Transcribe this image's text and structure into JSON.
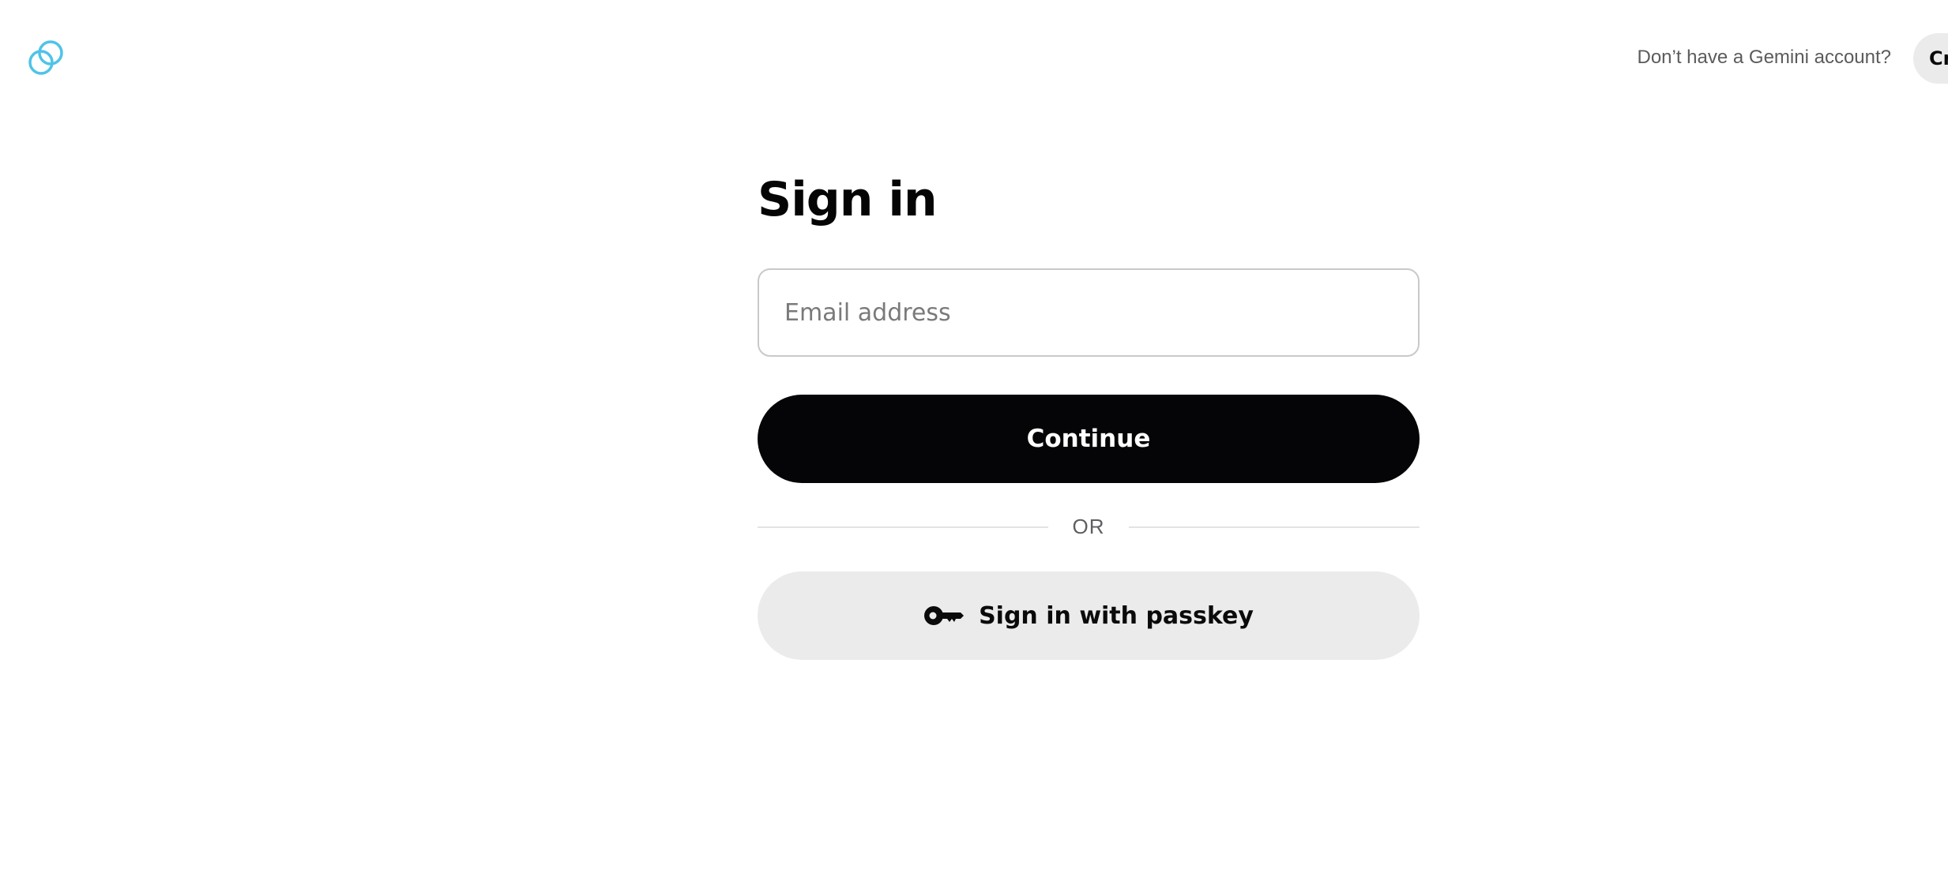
{
  "header": {
    "logo_icon": "gemini-logo-icon",
    "signup_prompt": "Don’t have a Gemini account?",
    "signup_button_label": "Create account"
  },
  "signin": {
    "title": "Sign in",
    "email_placeholder": "Email address",
    "email_value": "",
    "continue_label": "Continue",
    "divider_text": "OR",
    "passkey_label": "Sign in with passkey",
    "passkey_icon": "key-icon"
  },
  "colors": {
    "logo": "#4fc3e8",
    "primary_button": "#050507",
    "secondary_button": "#ebebeb",
    "muted_text": "#5b5b5e"
  }
}
